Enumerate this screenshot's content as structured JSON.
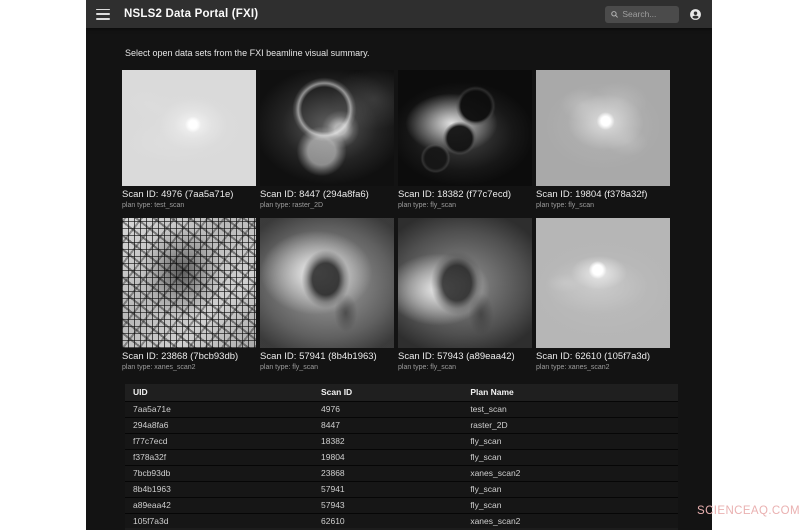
{
  "app": {
    "title": "NSLS2 Data Portal (FXI)",
    "search": {
      "placeholder": "Search..."
    }
  },
  "intro_text": "Select open data sets from the FXI beamline visual summary.",
  "scans": [
    {
      "scan_id": "4976",
      "uid": "7aa5a71e",
      "plan": "test_scan",
      "caption": "Scan ID: 4976 (7aa5a71e)",
      "plan_caption": "plan type: test_scan"
    },
    {
      "scan_id": "8447",
      "uid": "294a8fa6",
      "plan": "raster_2D",
      "caption": "Scan ID: 8447 (294a8fa6)",
      "plan_caption": "plan type: raster_2D"
    },
    {
      "scan_id": "18382",
      "uid": "f77c7ecd",
      "plan": "fly_scan",
      "caption": "Scan ID: 18382 (f77c7ecd)",
      "plan_caption": "plan type: fly_scan"
    },
    {
      "scan_id": "19804",
      "uid": "f378a32f",
      "plan": "fly_scan",
      "caption": "Scan ID: 19804 (f378a32f)",
      "plan_caption": "plan type: fly_scan"
    },
    {
      "scan_id": "23868",
      "uid": "7bcb93db",
      "plan": "xanes_scan2",
      "caption": "Scan ID: 23868 (7bcb93db)",
      "plan_caption": "plan type: xanes_scan2"
    },
    {
      "scan_id": "57941",
      "uid": "8b4b1963",
      "plan": "fly_scan",
      "caption": "Scan ID: 57941 (8b4b1963)",
      "plan_caption": "plan type: fly_scan"
    },
    {
      "scan_id": "57943",
      "uid": "a89eaa42",
      "plan": "fly_scan",
      "caption": "Scan ID: 57943 (a89eaa42)",
      "plan_caption": "plan type: fly_scan"
    },
    {
      "scan_id": "62610",
      "uid": "105f7a3d",
      "plan": "xanes_scan2",
      "caption": "Scan ID: 62610 (105f7a3d)",
      "plan_caption": "plan type: xanes_scan2"
    }
  ],
  "table": {
    "headers": [
      "UID",
      "Scan ID",
      "Plan Name"
    ],
    "rows": [
      [
        "7aa5a71e",
        "4976",
        "test_scan"
      ],
      [
        "294a8fa6",
        "8447",
        "raster_2D"
      ],
      [
        "f77c7ecd",
        "18382",
        "fly_scan"
      ],
      [
        "f378a32f",
        "19804",
        "fly_scan"
      ],
      [
        "7bcb93db",
        "23868",
        "xanes_scan2"
      ],
      [
        "8b4b1963",
        "57941",
        "fly_scan"
      ],
      [
        "a89eaa42",
        "57943",
        "fly_scan"
      ],
      [
        "105f7a3d",
        "62610",
        "xanes_scan2"
      ]
    ]
  },
  "watermark": "SCIENCEAQ.COM",
  "colors": {
    "appbar": "#2f2f2f",
    "content_bg": "#131313",
    "search_bg": "#4b4b4b",
    "table_header_bg": "#1f1f1f",
    "table_row_bg": "#161616",
    "watermark": "#eab1b1"
  }
}
